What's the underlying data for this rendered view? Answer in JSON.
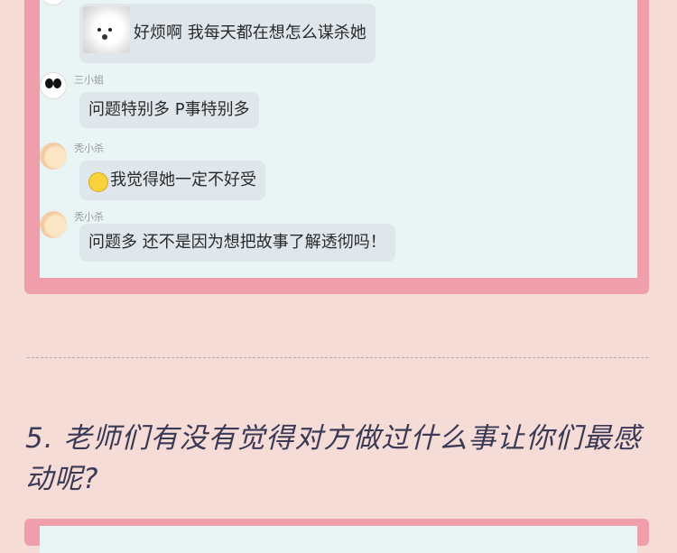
{
  "chat": {
    "messages": [
      {
        "sender": "",
        "avatar": "panda-avatar",
        "text": "好烦啊 我每天都在想怎么谋杀她",
        "has_image": true
      },
      {
        "sender": "三小姐",
        "avatar": "panda-avatar",
        "text": "问题特别多 P事特别多"
      },
      {
        "sender": "秃小杀",
        "avatar": "peach-avatar",
        "text": "我觉得她一定不好受",
        "emoji": "thinking-face-icon"
      },
      {
        "sender": "秃小杀",
        "avatar": "peach-avatar",
        "text": "问题多 还不是因为想把故事了解透彻吗！"
      }
    ]
  },
  "question": {
    "text": "5. 老师们有没有觉得对方做过什么事让你们最感动呢?"
  },
  "colors": {
    "page_bg": "#f6dcd6",
    "card_border": "#ef9fab",
    "chat_bg": "#e9f4f4",
    "bubble_bg": "#dfe6ec",
    "question_text": "#3a3a56"
  }
}
